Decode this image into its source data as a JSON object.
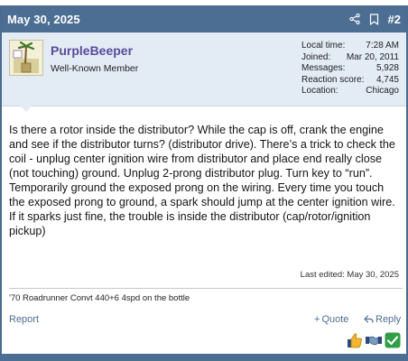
{
  "post": {
    "date": "May 30, 2025",
    "number": "#2",
    "author": {
      "name": "PurpleBeeper",
      "title": "Well-Known Member"
    },
    "stats": [
      {
        "label": "Local time:",
        "value": "7:28 AM"
      },
      {
        "label": "Joined:",
        "value": "Mar 20, 2011"
      },
      {
        "label": "Messages:",
        "value": "5,928"
      },
      {
        "label": "Reaction score:",
        "value": "4,745"
      },
      {
        "label": "Location:",
        "value": "Chicago"
      }
    ],
    "body": "Is there a rotor inside the distributor? While the cap is off, crank the engine and see if the distributor turns? (distributor drive). There’s a trick to check the coil - unplug center ignition wire from distributor and place end really close (not touching) ground. Unplug 2-prong distributor plug. Turn key to “run”. Temporarily ground the exposed prong on the wiring. Every time you touch the exposed prong to ground, a spark should jump at the center ignition wire. If it sparks just fine, the trouble is inside the distributor (cap/rotor/ignition pickup)",
    "last_edited": "Last edited: May 30, 2025",
    "signature": "'70 Roadrunner Convt 440+6 4spd on the bottle"
  },
  "actions": {
    "report": "Report",
    "quote": "Quote",
    "quote_prefix": "+",
    "reply": "Reply"
  },
  "icons": {
    "share": "share-icon",
    "bookmark": "bookmark-icon",
    "reply": "reply-arrow-icon",
    "reactions": [
      "thumbs-up-icon",
      "handshake-icon",
      "checkmark-icon"
    ]
  },
  "colors": {
    "header": "#4d6e93",
    "userbar": "#e3ebf5",
    "username": "#5a4a9a",
    "link": "#4d6e93",
    "check": "#2f9e44"
  }
}
